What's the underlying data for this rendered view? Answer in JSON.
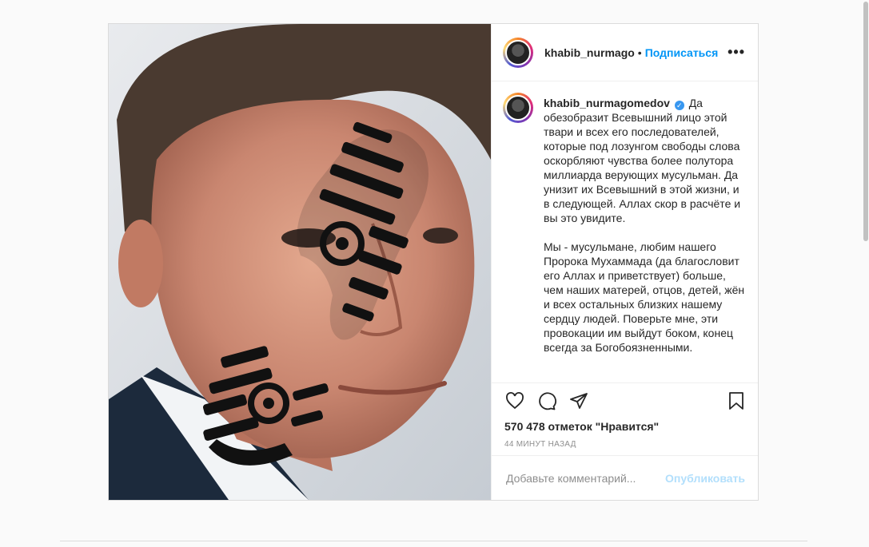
{
  "post": {
    "header": {
      "username": "khabib_nurmago",
      "dot": "•",
      "follow_label": "Подписаться",
      "more_icon": "more-horizontal-icon"
    },
    "caption": {
      "author": "khabib_nurmagomedov",
      "verified_icon": "verified-badge-icon",
      "paragraph1": "Да обезобразит Всевышний лицо этой твари и всех его последователей, которые под лозунгом свободы слова оскорбляют чувства более полутора миллиарда верующих мусульман. Да унизит их Всевышний в этой жизни, и в следующей. Аллах скор в расчёте и вы это увидите.",
      "paragraph2": "Мы - мусульмане, любим нашего Пророка Мухаммада (да благословит его Аллах и приветствует) больше, чем наших матерей, отцов, детей, жён и всех остальных близких нашему сердцу людей. Поверьте мне, эти провокации им выйдут боком, конец всегда за Богобоязненными."
    },
    "actions": {
      "icons": [
        "heart-icon",
        "comment-icon",
        "share-icon",
        "bookmark-icon"
      ]
    },
    "likes": "570 478 отметок \"Нравится\"",
    "time": "44 минут назад",
    "comment": {
      "placeholder": "Добавьте комментарий...",
      "publish_label": "Опубликовать"
    }
  },
  "colors": {
    "accent": "#0095f6",
    "publish_disabled": "#b2dffc",
    "border": "#dbdbdb",
    "background": "#fafafa"
  }
}
